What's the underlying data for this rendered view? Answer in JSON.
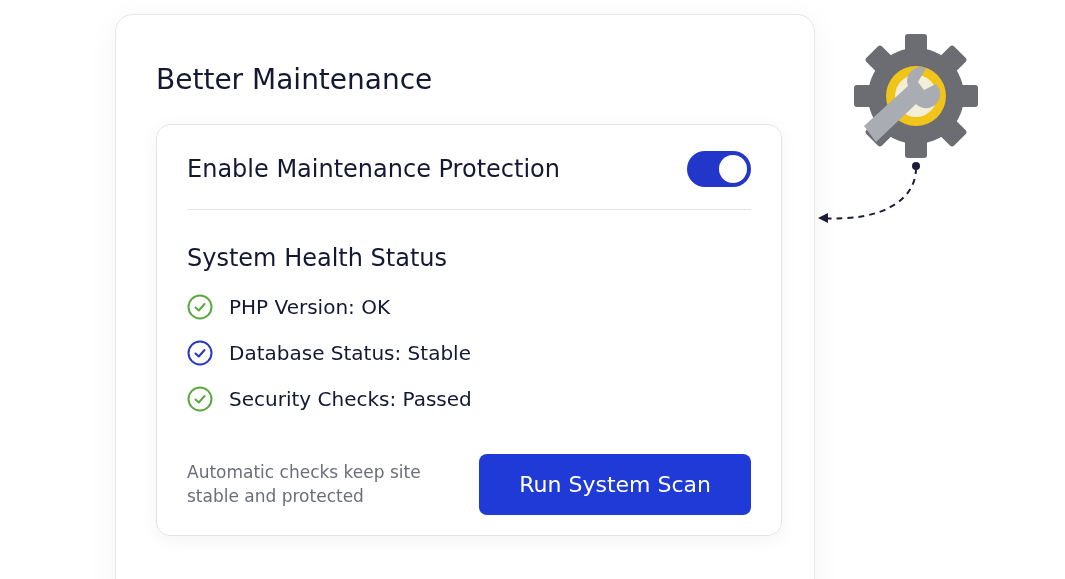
{
  "card": {
    "title": "Better Maintenance"
  },
  "protection": {
    "label": "Enable Maintenance Protection",
    "on": true
  },
  "health": {
    "title": "System Health Status",
    "checks": [
      {
        "label": "PHP Version: OK",
        "color": "#5ba843"
      },
      {
        "label": "Database Status: Stable",
        "color": "#2a36c4"
      },
      {
        "label": "Security Checks: Passed",
        "color": "#5ba843"
      }
    ]
  },
  "footer": {
    "note": "Automatic checks keep site stable and protected",
    "button": "Run System Scan"
  }
}
